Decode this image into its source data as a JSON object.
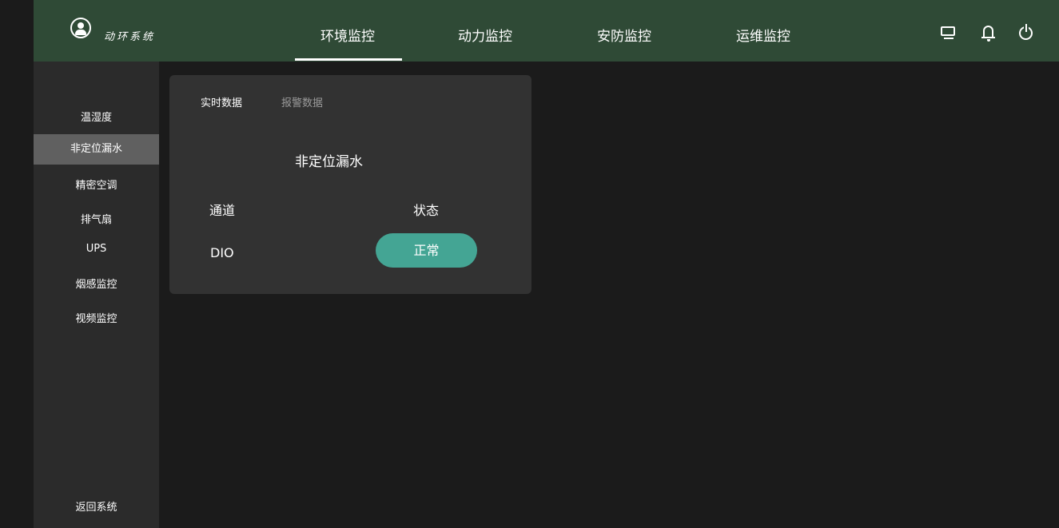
{
  "app": {
    "logo_text": "动环系统"
  },
  "header": {
    "nav": [
      {
        "label": "环境监控",
        "active": true
      },
      {
        "label": "动力监控",
        "active": false
      },
      {
        "label": "安防监控",
        "active": false
      },
      {
        "label": "运维监控",
        "active": false
      }
    ],
    "icons": [
      "monitor-icon",
      "bell-icon",
      "power-icon"
    ],
    "bg_color": "#2f4a36"
  },
  "sidebar": {
    "items": [
      {
        "label": "温湿度",
        "active": false
      },
      {
        "label": "非定位漏水",
        "active": true
      },
      {
        "label": "精密空调",
        "active": false
      },
      {
        "label": "排气扇",
        "active": false
      },
      {
        "label": "UPS",
        "active": false
      },
      {
        "label": "烟感监控",
        "active": false
      },
      {
        "label": "视频监控",
        "active": false
      }
    ],
    "footer": "返回系统"
  },
  "panel": {
    "tabs": [
      {
        "label": "实时数据",
        "active": true
      },
      {
        "label": "报警数据",
        "active": false
      }
    ],
    "device_title": "非定位漏水",
    "columns": {
      "channel": "通道",
      "status": "状态"
    },
    "rows": [
      {
        "channel": "DIO",
        "status": "正常"
      }
    ],
    "status_color": "#44a594"
  }
}
